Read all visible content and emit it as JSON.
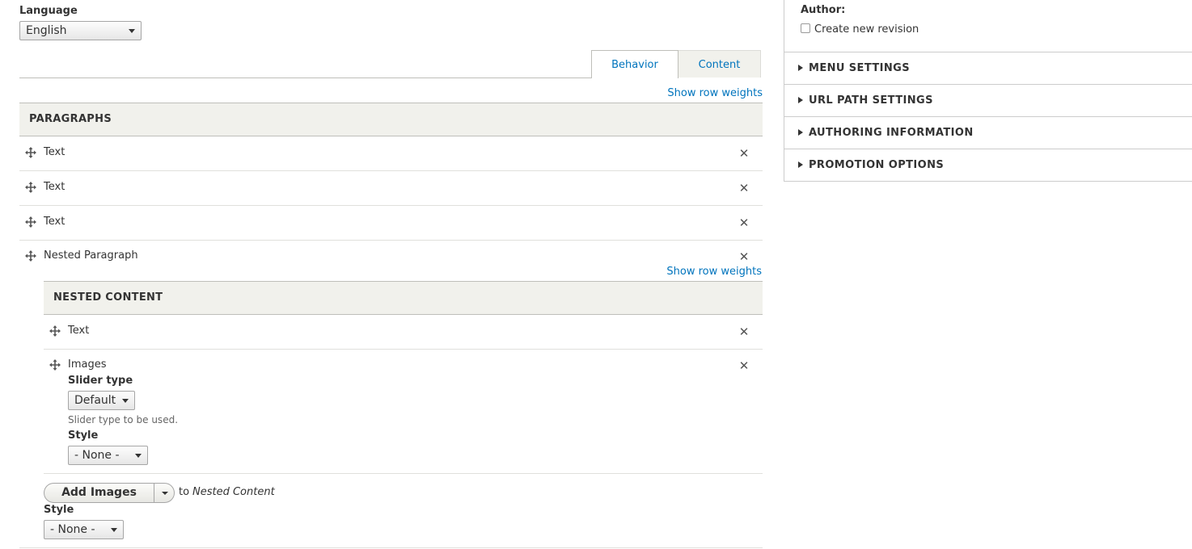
{
  "language": {
    "label": "Language",
    "value": "English"
  },
  "tabs": {
    "behavior": "Behavior",
    "content": "Content"
  },
  "show_row_weights": "Show row weights",
  "paragraphs": {
    "header": "PARAGRAPHS",
    "rows": [
      "Text",
      "Text",
      "Text",
      "Nested Paragraph"
    ],
    "nested": {
      "show_row_weights": "Show row weights",
      "header": "NESTED CONTENT",
      "rows": [
        "Text",
        "Images"
      ],
      "slider_type_label": "Slider type",
      "slider_type_value": "Default",
      "slider_type_desc": "Slider type to be used.",
      "style_label": "Style",
      "style_value": "- None -"
    },
    "add_button": "Add Images",
    "add_to": "to",
    "add_target": "Nested Content",
    "style_label": "Style",
    "style_value": "- None -"
  },
  "sidebar": {
    "author_label": "Author:",
    "revision_label": "Create new revision",
    "revision_checked": false,
    "sections": [
      "MENU SETTINGS",
      "URL PATH SETTINGS",
      "AUTHORING INFORMATION",
      "PROMOTION OPTIONS"
    ]
  },
  "colors": {
    "link": "#0074bd",
    "header_bg": "#f1f1ec",
    "tab_active_border": "#bfbfba"
  },
  "icons": {
    "drag": "move-arrows-icon",
    "remove": "close-x-icon",
    "expand": "triangle-right-icon"
  }
}
